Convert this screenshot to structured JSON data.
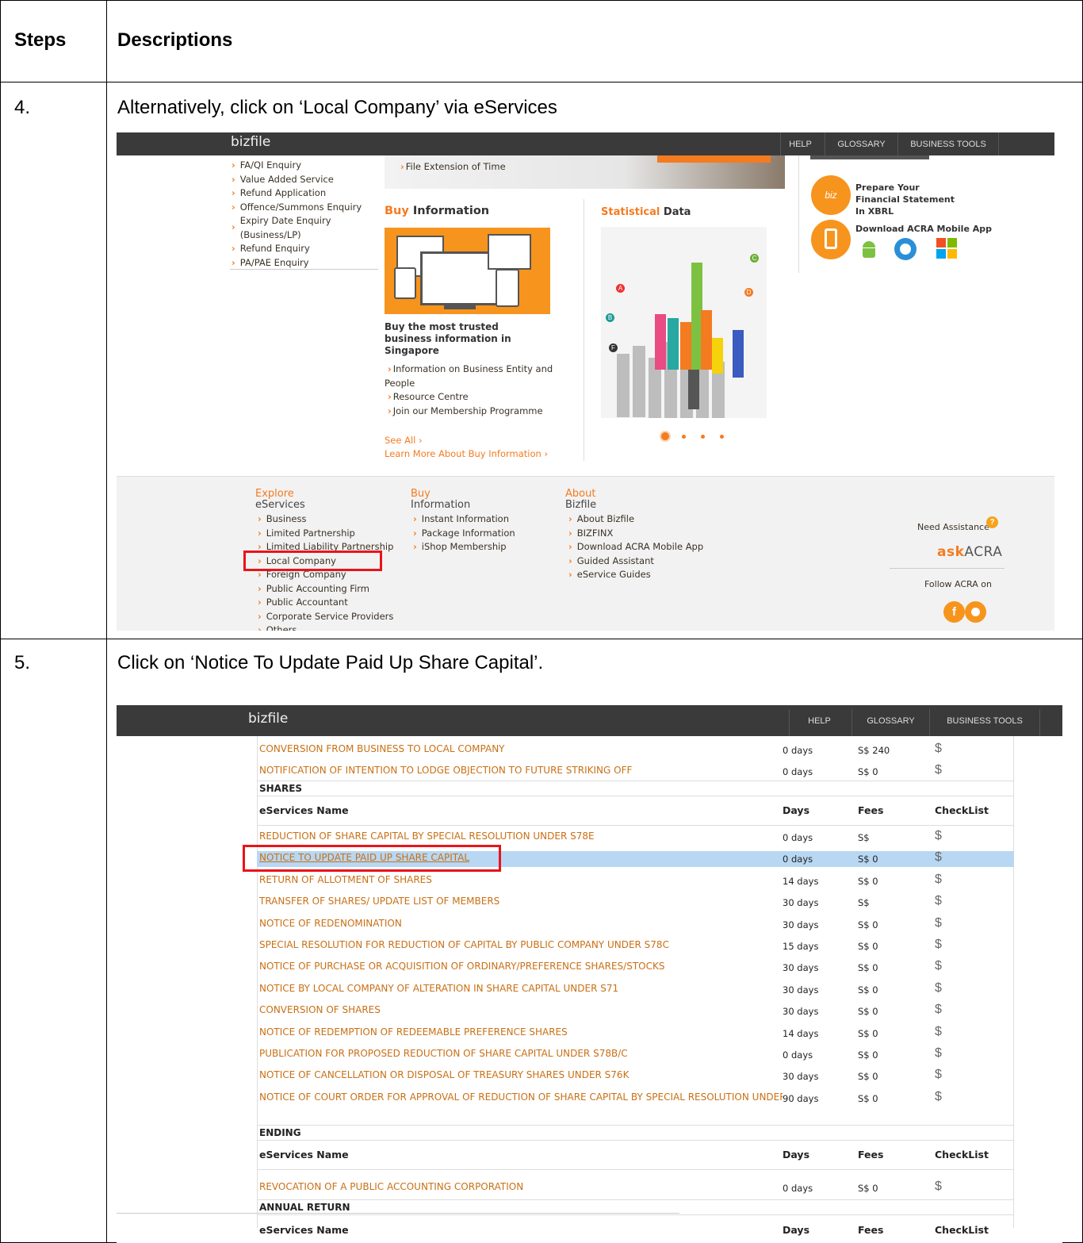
{
  "table": {
    "headers": {
      "steps": "Steps",
      "descriptions": "Descriptions"
    },
    "step4": {
      "num": "4.",
      "text": "Alternatively, click on ‘Local Company’ via eServices"
    },
    "step5": {
      "num": "5.",
      "text": "Click on ‘Notice To Update Paid Up Share Capital’."
    }
  },
  "shot1": {
    "logo": "bizfile",
    "nav": [
      "HELP",
      "GLOSSARY",
      "BUSINESS TOOLS"
    ],
    "left_links": [
      "FA/QI Enquiry",
      "Value Added Service",
      "Refund Application",
      "Offence/Summons Enquiry",
      "Expiry Date Enquiry (Business/LP)",
      "Refund Enquiry",
      "PA/PAE Enquiry"
    ],
    "file_ext": "File Extension of Time",
    "buy_info": {
      "t1": "Buy",
      "t2": "Information",
      "caption": "Buy the most trusted business information in Singapore",
      "links": [
        "Information on Business Entity and People",
        "Resource Centre",
        "Join our Membership Programme"
      ],
      "see_all": "See All",
      "learn_more": "Learn More About Buy Information"
    },
    "stat": {
      "t1": "Statistical",
      "t2": "Data",
      "labels": [
        "A",
        "B",
        "C",
        "D",
        "F"
      ]
    },
    "right": {
      "xbrl": "Prepare Your Financial Statement In XBRL",
      "bizfin": "biz",
      "mobile": "Download ACRA Mobile App"
    },
    "footer": {
      "explore": {
        "t1": "Explore",
        "t2": "eServices",
        "items": [
          "Business",
          "Limited Partnership",
          "Limited Liability Partnership",
          "Local Company",
          "Foreign Company",
          "Public Accounting Firm",
          "Public Accountant",
          "Corporate Service Providers",
          "Others"
        ]
      },
      "buy": {
        "t1": "Buy",
        "t2": "Information",
        "items": [
          "Instant Information",
          "Package Information",
          "iShop Membership"
        ]
      },
      "about": {
        "t1": "About",
        "t2": "Bizfile",
        "items": [
          "About Bizfile",
          "BIZFINX",
          "Download ACRA Mobile App",
          "Guided Assistant",
          "eService Guides"
        ]
      },
      "assist": "Need Assistance",
      "ask1": "ask",
      "ask2": "ACRA",
      "follow": "Follow ACRA on",
      "fb": "f"
    }
  },
  "shot2": {
    "logo": "bizfile",
    "nav": [
      "HELP",
      "GLOSSARY",
      "BUSINESS TOOLS"
    ],
    "cols": {
      "name": "eServices Name",
      "days": "Days",
      "fees": "Fees",
      "check": "CheckList"
    },
    "top_rows": [
      {
        "name": "CONVERSION FROM BUSINESS TO LOCAL COMPANY",
        "days": "0 days",
        "fees": "S$ 240"
      },
      {
        "name": "NOTIFICATION OF INTENTION TO LODGE OBJECTION TO FUTURE STRIKING OFF",
        "days": "0 days",
        "fees": "S$ 0"
      }
    ],
    "sections": [
      "SHARES",
      "ENDING",
      "ANNUAL RETURN"
    ],
    "shares_rows": [
      {
        "name": "REDUCTION OF SHARE CAPITAL BY SPECIAL RESOLUTION UNDER S78E",
        "days": "0 days",
        "fees": "S$"
      },
      {
        "name": "NOTICE TO UPDATE PAID UP SHARE CAPITAL",
        "days": "0 days",
        "fees": "S$ 0"
      },
      {
        "name": "RETURN OF ALLOTMENT OF SHARES",
        "days": "14 days",
        "fees": "S$ 0"
      },
      {
        "name": "TRANSFER OF SHARES/ UPDATE LIST OF MEMBERS",
        "days": "30 days",
        "fees": "S$"
      },
      {
        "name": "NOTICE OF REDENOMINATION",
        "days": "30 days",
        "fees": "S$ 0"
      },
      {
        "name": "SPECIAL RESOLUTION FOR REDUCTION OF CAPITAL BY PUBLIC COMPANY UNDER S78C",
        "days": "15 days",
        "fees": "S$ 0"
      },
      {
        "name": "NOTICE OF PURCHASE OR ACQUISITION OF ORDINARY/PREFERENCE SHARES/STOCKS",
        "days": "30 days",
        "fees": "S$ 0"
      },
      {
        "name": "NOTICE BY LOCAL COMPANY OF ALTERATION IN SHARE CAPITAL UNDER S71",
        "days": "30 days",
        "fees": "S$ 0"
      },
      {
        "name": "CONVERSION OF SHARES",
        "days": "30 days",
        "fees": "S$ 0"
      },
      {
        "name": "NOTICE OF REDEMPTION OF REDEEMABLE PREFERENCE SHARES",
        "days": "14 days",
        "fees": "S$ 0"
      },
      {
        "name": "PUBLICATION FOR PROPOSED REDUCTION OF SHARE CAPITAL UNDER S78B/C",
        "days": "0 days",
        "fees": "S$ 0"
      },
      {
        "name": "NOTICE OF CANCELLATION OR DISPOSAL OF TREASURY SHARES UNDER S76K",
        "days": "30 days",
        "fees": "S$ 0"
      },
      {
        "name": "NOTICE OF COURT ORDER FOR APPROVAL OF REDUCTION OF SHARE CAPITAL BY SPECIAL RESOLUTION UNDER S",
        "days": "90 days",
        "fees": "S$ 0"
      }
    ],
    "ending_rows": [
      {
        "name": "REVOCATION OF A PUBLIC ACCOUNTING CORPORATION",
        "days": "0 days",
        "fees": "S$ 0"
      }
    ],
    "icon": "$"
  }
}
